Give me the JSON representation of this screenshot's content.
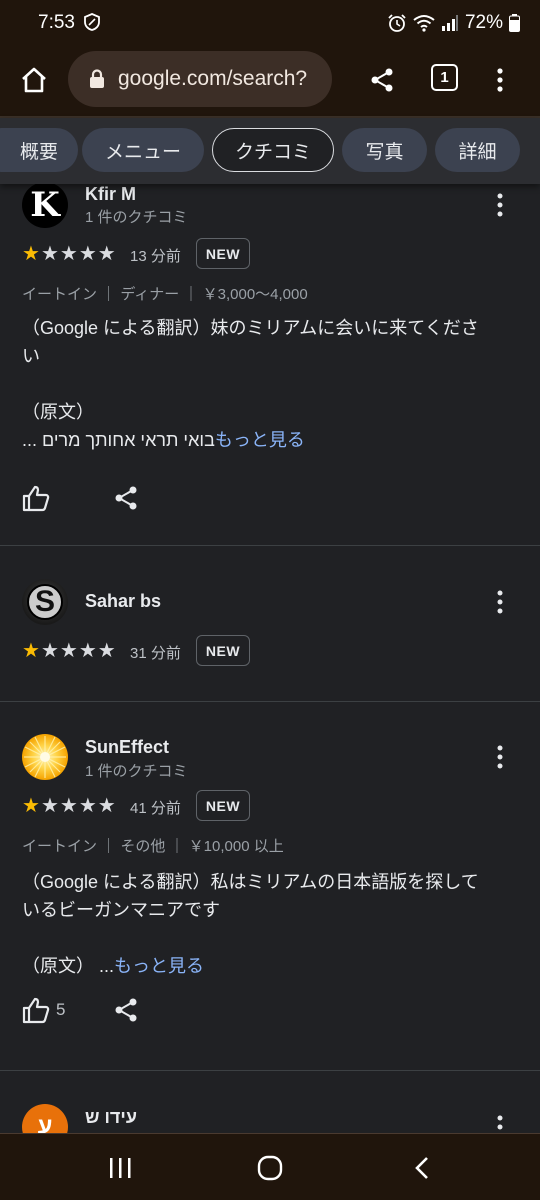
{
  "status_bar": {
    "time": "7:53",
    "battery": "72%"
  },
  "browser": {
    "url": "google.com/search?",
    "tab_count": "1"
  },
  "chips": [
    {
      "label": "概要"
    },
    {
      "label": "メニュー"
    },
    {
      "label": "クチコミ",
      "selected": true
    },
    {
      "label": "写真"
    },
    {
      "label": "詳細"
    }
  ],
  "reviews": [
    {
      "name": "Kfir M",
      "review_count": "1 件のクチコミ",
      "rating": 1,
      "time": "13 分前",
      "badge": "NEW",
      "meta": "イートイン ｜ ディナー ｜ ￥3,000～4,000",
      "translated_line1": "（Google による翻訳）妹のミリアムに会いに来てくださ",
      "translated_line2": "い",
      "original_label": "（原文）",
      "original_text": "בואי תראי אחותך מרים ...",
      "more": "もっと見る",
      "likes": ""
    },
    {
      "name": "Sahar bs",
      "rating": 1,
      "time": "31 分前",
      "badge": "NEW"
    },
    {
      "name": "SunEffect",
      "review_count": "1 件のクチコミ",
      "rating": 1,
      "time": "41 分前",
      "badge": "NEW",
      "meta": "イートイン ｜ その他 ｜ ￥10,000 以上",
      "translated_line1": "（Google による翻訳）私はミリアムの日本語版を探して",
      "translated_line2": "いるビーガンマニアです",
      "original_label": "（原文） ...",
      "more": "もっと見る",
      "likes": "5"
    },
    {
      "name": "עידו ש",
      "avatar_letter": "ע"
    }
  ],
  "colors": {
    "star": "#fbbc04",
    "link": "#8ab4f8",
    "chip": "#3c4250",
    "orange_avatar": "#e8710a"
  }
}
